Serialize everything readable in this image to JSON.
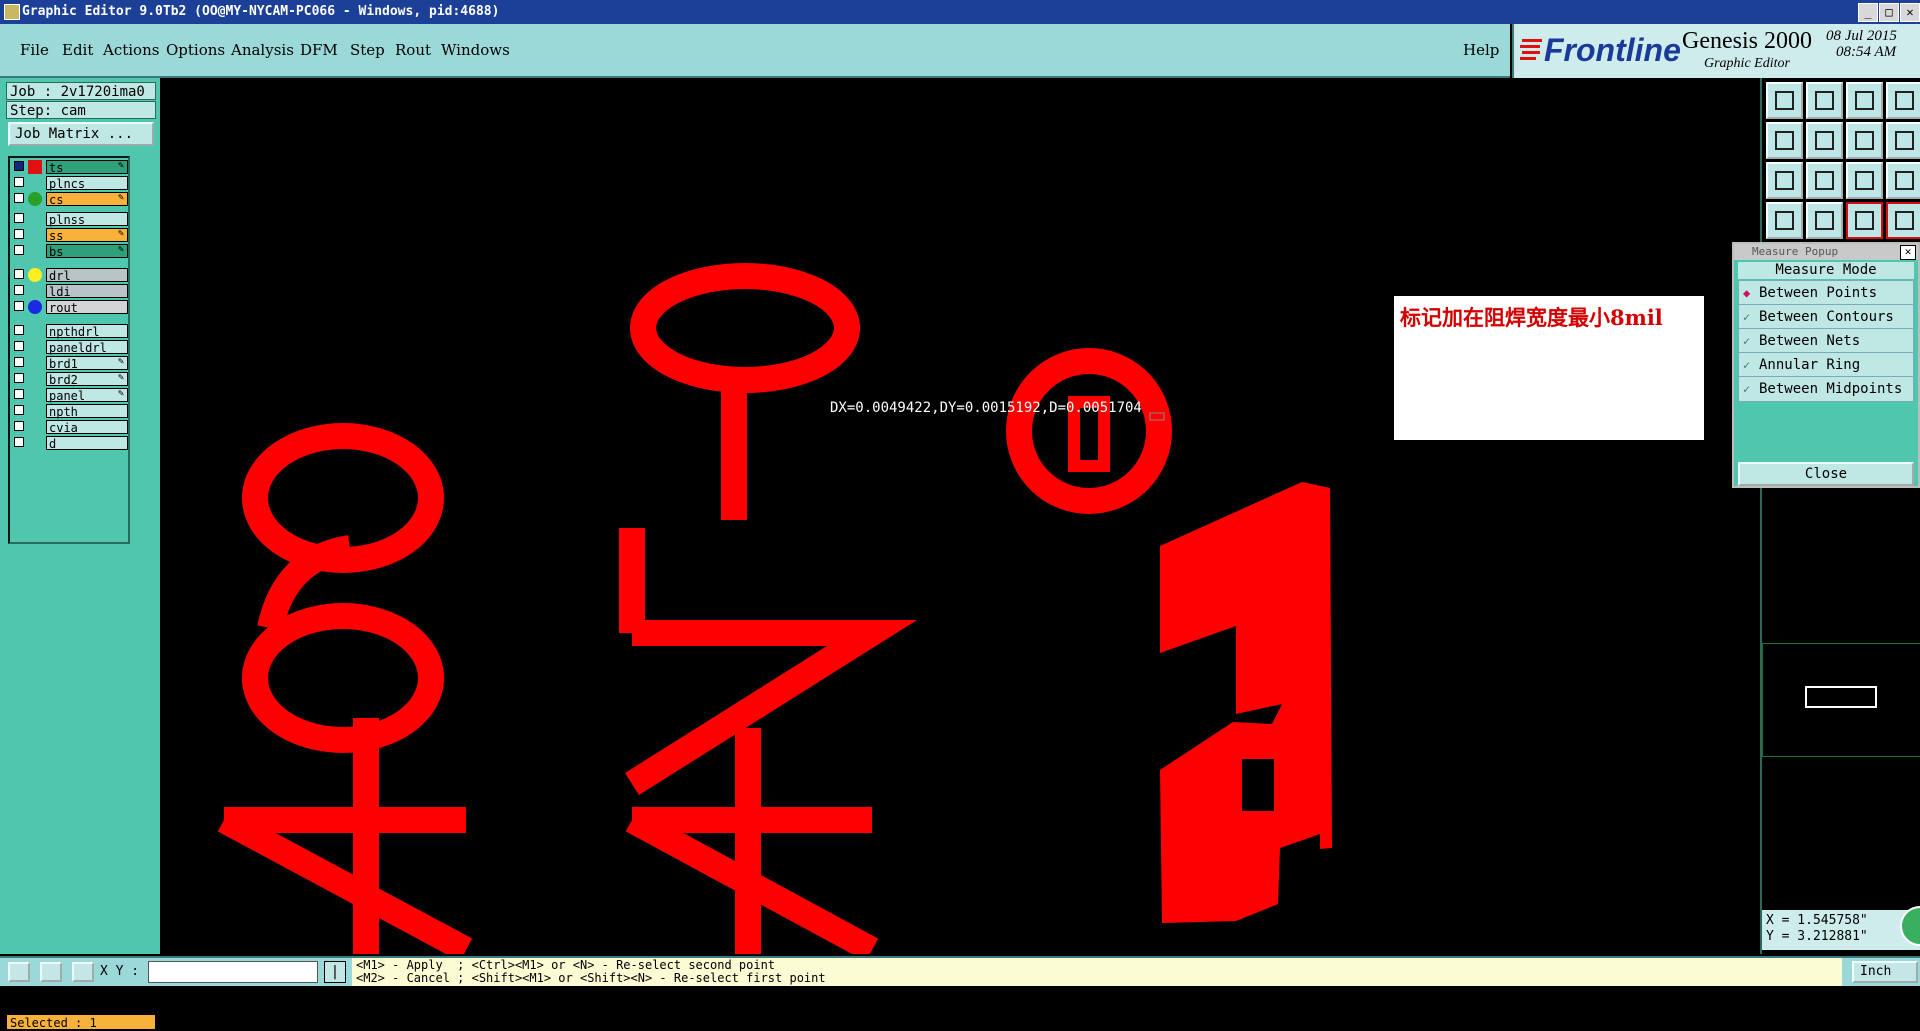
{
  "window": {
    "title": "Graphic Editor 9.0Tb2 (OO@MY-NYCAM-PC066 - Windows, pid:4688)",
    "controls": [
      "_",
      "□",
      "✕"
    ]
  },
  "menu": {
    "items": [
      "File",
      "Edit",
      "Actions",
      "Options",
      "Analysis",
      "DFM",
      "Step",
      "Rout",
      "Windows"
    ],
    "help": "Help"
  },
  "brand": {
    "logo": "Frontline",
    "product": "Genesis 2000",
    "subtitle": "Graphic Editor",
    "date": "08 Jul 2015",
    "time": "08:54 AM"
  },
  "left": {
    "job": "Job : 2v1720ima0",
    "step": "Step: cam",
    "job_matrix": "Job Matrix ...",
    "layers": [
      {
        "name": "ts",
        "bg": "#2fa07a",
        "swatch": "arrow",
        "edit": true,
        "active": true
      },
      {
        "name": "plncs",
        "bg": "#bfe8e4",
        "swatch": "",
        "edit": false
      },
      {
        "name": "cs",
        "bg": "#f8b23a",
        "swatch": "#2aa02a",
        "edit": true
      },
      {
        "name": "plnss",
        "bg": "#bfe8e4",
        "swatch": "",
        "edit": false
      },
      {
        "name": "ss",
        "bg": "#f8b23a",
        "swatch": "",
        "edit": true
      },
      {
        "name": "bs",
        "bg": "#2fa07a",
        "swatch": "",
        "edit": true
      },
      {
        "name": "drl",
        "bg": "#b8c4c8",
        "swatch": "#ffee20",
        "edit": false
      },
      {
        "name": "ldi",
        "bg": "#b8c4c8",
        "swatch": "",
        "edit": false
      },
      {
        "name": "rout",
        "bg": "#d4d4d4",
        "swatch": "#1a2ae0",
        "edit": false
      },
      {
        "name": "npthdrl",
        "bg": "#bfe8e4",
        "swatch": "",
        "edit": false
      },
      {
        "name": "paneldrl",
        "bg": "#bfe8e4",
        "swatch": "",
        "edit": false
      },
      {
        "name": "brd1",
        "bg": "#bfe8e4",
        "swatch": "",
        "edit": true
      },
      {
        "name": "brd2",
        "bg": "#bfe8e4",
        "swatch": "",
        "edit": true
      },
      {
        "name": "panel",
        "bg": "#bfe8e4",
        "swatch": "",
        "edit": true
      },
      {
        "name": "npth",
        "bg": "#bfe8e4",
        "swatch": "",
        "edit": false
      },
      {
        "name": "cvia",
        "bg": "#bfe8e4",
        "swatch": "",
        "edit": false
      },
      {
        "name": "d",
        "bg": "#bfe8e4",
        "swatch": "",
        "edit": false
      }
    ],
    "selected": "Selected : 1"
  },
  "canvas": {
    "measure": "DX=0.0049422,DY=0.0015192,D=0.0051704",
    "note": "标记加在阻焊宽度最小8mil",
    "artwork_texts": [
      "460",
      "4V-0"
    ]
  },
  "popup": {
    "title": "Measure Popup",
    "mode_label": "Measure Mode",
    "options": [
      "Between Points",
      "Between Contours",
      "Between Nets",
      "Annular Ring",
      "Between Midpoints"
    ],
    "selected_option": "Between Points",
    "close": "Close"
  },
  "coords": {
    "x": "X = 1.545758\"",
    "y": "Y = 3.212881\""
  },
  "bottom": {
    "xy_label": "X Y :",
    "hint_line1": "<M1> - Apply  ; <Ctrl><M1> or <N> - Re-select second point",
    "hint_line2": "<M2> - Cancel ; <Shift><M1> or <Shift><N> - Re-select first point",
    "unit": "Inch"
  },
  "colors": {
    "accent": "#4fc6ae",
    "artwork": "#ff0000",
    "titlebar": "#1c3f97"
  }
}
